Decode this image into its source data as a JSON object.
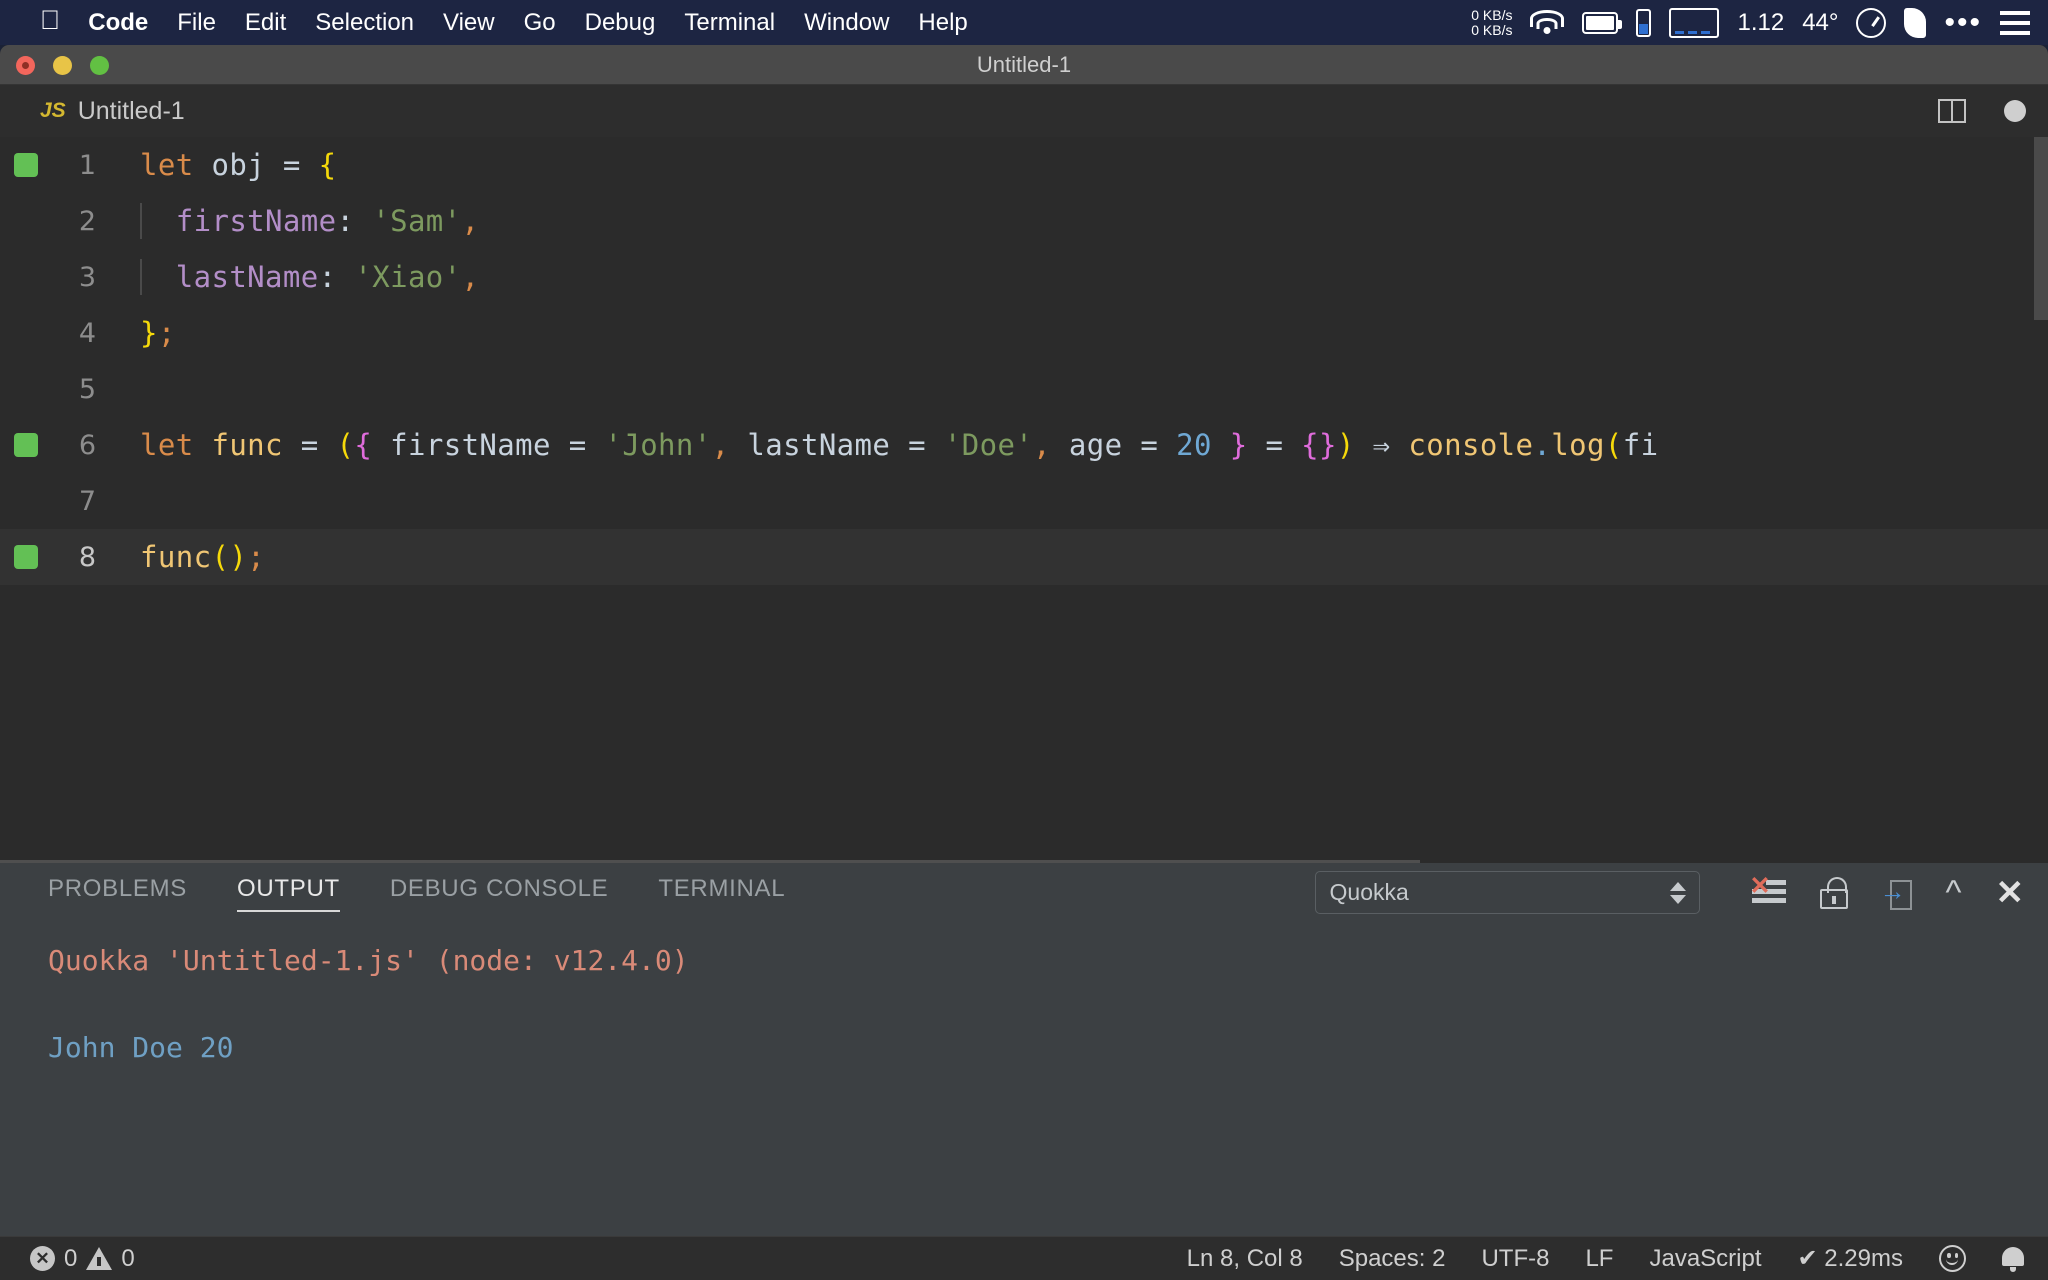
{
  "menubar": {
    "apple_icon": "apple-icon",
    "items": [
      {
        "label": "Code",
        "bold": true
      },
      {
        "label": "File",
        "bold": false
      },
      {
        "label": "Edit",
        "bold": false
      },
      {
        "label": "Selection",
        "bold": false
      },
      {
        "label": "View",
        "bold": false
      },
      {
        "label": "Go",
        "bold": false
      },
      {
        "label": "Debug",
        "bold": false
      },
      {
        "label": "Terminal",
        "bold": false
      },
      {
        "label": "Window",
        "bold": false
      },
      {
        "label": "Help",
        "bold": false
      }
    ],
    "status": {
      "net_up": "0 KB/s",
      "net_down": "0 KB/s",
      "cpu_load": "1.12",
      "temperature": "44°"
    }
  },
  "window": {
    "title": "Untitled-1"
  },
  "editor_tab": {
    "badge": "JS",
    "label": "Untitled-1"
  },
  "code": {
    "lines": [
      {
        "num": "1",
        "marker": true,
        "active": false,
        "indent": false,
        "tokens": [
          {
            "t": "let",
            "c": "t-key"
          },
          {
            "t": " ",
            "c": "t-var"
          },
          {
            "t": "obj",
            "c": "t-var"
          },
          {
            "t": " = ",
            "c": "t-op"
          },
          {
            "t": "{",
            "c": "t-brace1"
          }
        ]
      },
      {
        "num": "2",
        "marker": false,
        "active": false,
        "indent": true,
        "tokens": [
          {
            "t": "  ",
            "c": "t-var"
          },
          {
            "t": "firstName",
            "c": "t-prop"
          },
          {
            "t": ": ",
            "c": "t-var"
          },
          {
            "t": "'Sam'",
            "c": "t-str"
          },
          {
            "t": ",",
            "c": "t-punc"
          }
        ]
      },
      {
        "num": "3",
        "marker": false,
        "active": false,
        "indent": true,
        "tokens": [
          {
            "t": "  ",
            "c": "t-var"
          },
          {
            "t": "lastName",
            "c": "t-prop"
          },
          {
            "t": ": ",
            "c": "t-var"
          },
          {
            "t": "'Xiao'",
            "c": "t-str"
          },
          {
            "t": ",",
            "c": "t-punc"
          }
        ]
      },
      {
        "num": "4",
        "marker": false,
        "active": false,
        "indent": false,
        "tokens": [
          {
            "t": "}",
            "c": "t-brace1"
          },
          {
            "t": ";",
            "c": "t-punc"
          }
        ]
      },
      {
        "num": "5",
        "marker": false,
        "active": false,
        "indent": false,
        "tokens": []
      },
      {
        "num": "6",
        "marker": true,
        "active": false,
        "indent": false,
        "tokens": [
          {
            "t": "let",
            "c": "t-key"
          },
          {
            "t": " func",
            "c": "t-func"
          },
          {
            "t": " = ",
            "c": "t-op"
          },
          {
            "t": "(",
            "c": "t-brace1"
          },
          {
            "t": "{",
            "c": "t-brace2"
          },
          {
            "t": " ",
            "c": "t-var"
          },
          {
            "t": "firstName",
            "c": "t-var"
          },
          {
            "t": " = ",
            "c": "t-op"
          },
          {
            "t": "'John'",
            "c": "t-str"
          },
          {
            "t": ",",
            "c": "t-punc"
          },
          {
            "t": " lastName",
            "c": "t-var"
          },
          {
            "t": " = ",
            "c": "t-op"
          },
          {
            "t": "'Doe'",
            "c": "t-str"
          },
          {
            "t": ",",
            "c": "t-punc"
          },
          {
            "t": " age",
            "c": "t-var"
          },
          {
            "t": " = ",
            "c": "t-op"
          },
          {
            "t": "20",
            "c": "t-num"
          },
          {
            "t": " ",
            "c": "t-var"
          },
          {
            "t": "}",
            "c": "t-brace2"
          },
          {
            "t": " = ",
            "c": "t-op"
          },
          {
            "t": "{}",
            "c": "t-brace2"
          },
          {
            "t": ")",
            "c": "t-brace1"
          },
          {
            "t": " ⇒ ",
            "c": "t-arrow"
          },
          {
            "t": "console",
            "c": "t-func"
          },
          {
            "t": ".",
            "c": "t-dot"
          },
          {
            "t": "log",
            "c": "t-func"
          },
          {
            "t": "(",
            "c": "t-brace1"
          },
          {
            "t": "fi",
            "c": "t-var"
          }
        ]
      },
      {
        "num": "7",
        "marker": false,
        "active": false,
        "indent": false,
        "tokens": []
      },
      {
        "num": "8",
        "marker": true,
        "active": true,
        "indent": false,
        "tokens": [
          {
            "t": "func",
            "c": "t-func"
          },
          {
            "t": "()",
            "c": "t-brace1"
          },
          {
            "t": ";",
            "c": "t-punc"
          }
        ]
      }
    ]
  },
  "panel": {
    "tabs": [
      {
        "label": "PROBLEMS",
        "active": false
      },
      {
        "label": "OUTPUT",
        "active": true
      },
      {
        "label": "DEBUG CONSOLE",
        "active": false
      },
      {
        "label": "TERMINAL",
        "active": false
      }
    ],
    "select_value": "Quokka",
    "actions": [
      {
        "name": "clear-output-icon",
        "label": "Clear Output"
      },
      {
        "name": "lock-scroll-icon",
        "label": "Turn Auto Scrolling Off"
      },
      {
        "name": "open-in-editor-icon",
        "label": "Open Output in Editor"
      },
      {
        "name": "collapse-panel-icon",
        "label": "Maximize Panel Size"
      },
      {
        "name": "close-panel-icon",
        "label": "Close Panel"
      }
    ],
    "output": [
      {
        "text": "Quokka 'Untitled-1.js' (node: v12.4.0)",
        "cls": "out-head"
      },
      {
        "text": " ",
        "cls": "out-blank"
      },
      {
        "text": "John Doe 20",
        "cls": "out-val"
      }
    ]
  },
  "statusbar": {
    "errors": "0",
    "warnings": "0",
    "cursor": "Ln 8, Col 8",
    "indent": "Spaces: 2",
    "encoding": "UTF-8",
    "eol": "LF",
    "language": "JavaScript",
    "quokka_time": "✔ 2.29ms"
  },
  "colors": {
    "accent_green": "#63c055",
    "output_head": "#d98a78",
    "output_value": "#6fa0c4",
    "menubar_bg": "#1d2542",
    "panel_bg": "#3c4043",
    "editor_bg": "#2b2b2b"
  }
}
